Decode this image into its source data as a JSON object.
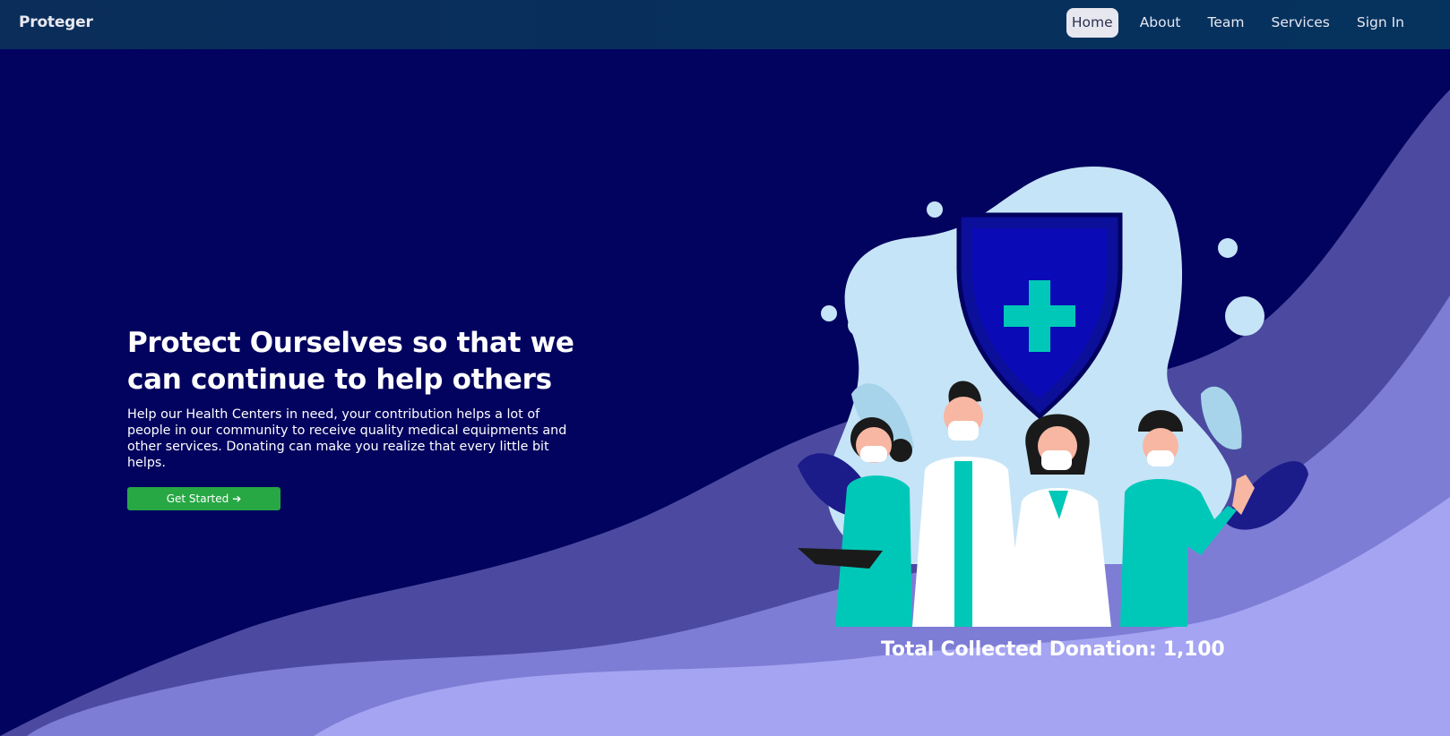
{
  "brand": "Proteger",
  "nav": {
    "items": [
      {
        "label": "Home",
        "active": true
      },
      {
        "label": "About"
      },
      {
        "label": "Team"
      },
      {
        "label": "Services"
      },
      {
        "label": "Sign In"
      }
    ]
  },
  "hero": {
    "headline": "Protect Ourselves so that we can continue to help others",
    "subtext": "Help our Health Centers in need, your contribution helps a lot of people in our community to receive quality medical equipments and other services. Donating can make you realize that every little bit helps.",
    "cta_label": "Get Started",
    "cta_icon": "arrow-right-icon"
  },
  "donation": {
    "label": "Total Collected Donation: 1,100"
  },
  "colors": {
    "navbar": "#06325e",
    "background": "#02025f",
    "wave_dark": "#4b4aa0",
    "wave_mid": "#7b7bd6",
    "wave_light": "#a4a4f2",
    "cta": "#28a745",
    "scrubs": "#00c8b8",
    "shield": "#0b0f9a",
    "blob": "#c6e4f7"
  }
}
